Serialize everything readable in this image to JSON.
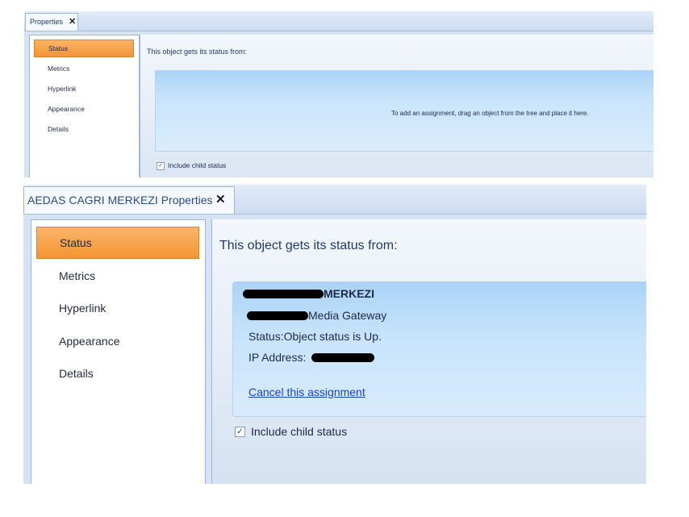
{
  "top_panel": {
    "tab_title": "Properties",
    "tab_close": "✕",
    "nav": [
      "Status",
      "Metrics",
      "Hyperlink",
      "Appearance",
      "Details"
    ],
    "active_nav": "Status",
    "heading": "This object gets its status from:",
    "dropzone_hint": "To add an assignment, drag an object from the tree and place it here.",
    "include_child_status": {
      "label": "Include child status",
      "checked": true,
      "mark": "✓"
    }
  },
  "bottom_panel": {
    "tab_title": "AEDAS CAGRI MERKEZI Properties",
    "tab_close": "✕",
    "nav": [
      "Status",
      "Metrics",
      "Hyperlink",
      "Appearance",
      "Details"
    ],
    "active_nav": "Status",
    "heading": "This object gets its status from:",
    "assignment": {
      "name_suffix": "MERKEZI",
      "type_suffix": "Media Gateway",
      "status_line": "Status:Object status is Up.",
      "ip_label": "IP Address:",
      "cancel_link": "Cancel this assignment"
    },
    "include_child_status": {
      "label": "Include child status",
      "checked": true,
      "mark": "✓"
    }
  },
  "colors": {
    "active_tab_orange": "#f49434",
    "panel_blue": "#d6e3f4",
    "gradient_blue": "#aad3f6",
    "link_blue": "#1a44c8"
  }
}
